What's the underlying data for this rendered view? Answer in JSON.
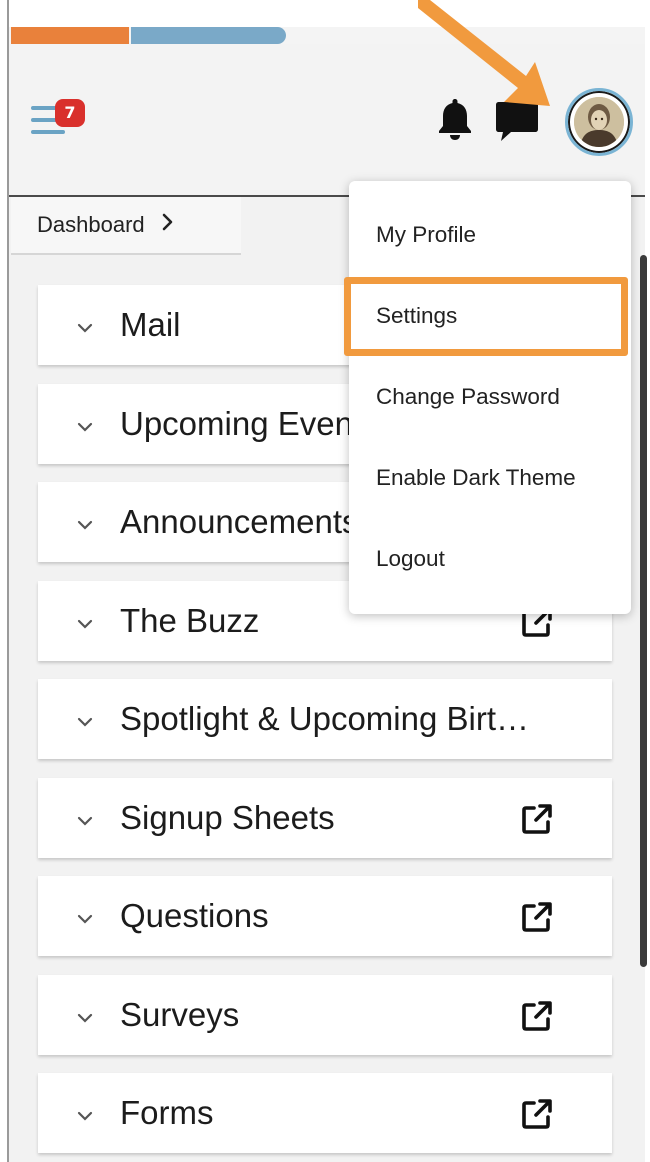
{
  "header": {
    "notification_badge": "7",
    "menu_icon": "hamburger-menu-icon",
    "bell_icon": "bell-icon",
    "chat_icon": "chat-bubble-icon",
    "avatar": "user-avatar"
  },
  "progress": {
    "orange": "#e9813b",
    "blue": "#7aa9c8"
  },
  "breadcrumb": {
    "label": "Dashboard"
  },
  "cards": [
    {
      "title": "Mail"
    },
    {
      "title": "Upcoming Events"
    },
    {
      "title": "Announcements"
    },
    {
      "title": "The Buzz"
    },
    {
      "title": "Spotlight & Upcoming Birt…"
    },
    {
      "title": "Signup Sheets"
    },
    {
      "title": "Questions"
    },
    {
      "title": "Surveys"
    },
    {
      "title": "Forms"
    }
  ],
  "dropdown": {
    "items": [
      {
        "label": "My Profile"
      },
      {
        "label": "Settings"
      },
      {
        "label": "Change Password"
      },
      {
        "label": "Enable Dark Theme"
      },
      {
        "label": "Logout"
      }
    ],
    "highlighted_index": 1,
    "highlight_color": "#f19a3e"
  },
  "colors": {
    "accent_blue": "#6aa3c4",
    "badge_red": "#d9302c",
    "annotation_orange": "#f19a3e"
  }
}
